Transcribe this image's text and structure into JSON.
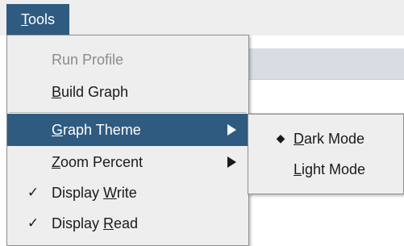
{
  "menubar": {
    "tools_menu": {
      "mnemonic": "T",
      "rest": "ools"
    }
  },
  "tools_menu": {
    "items": [
      {
        "pre": "Run Profile",
        "mnemonic": "",
        "post": "",
        "enabled": false
      },
      {
        "pre": "",
        "mnemonic": "B",
        "post": "uild Graph",
        "enabled": true
      },
      {
        "pre": "",
        "mnemonic": "G",
        "post": "raph Theme",
        "has_submenu": true,
        "highlighted": true,
        "submenu_icon": "chevron-right-icon"
      },
      {
        "pre": "",
        "mnemonic": "Z",
        "post": "oom Percent",
        "has_submenu": true,
        "submenu_icon": "chevron-right-icon"
      },
      {
        "check": "✓",
        "checked": true,
        "pre": "Display ",
        "mnemonic": "W",
        "post": "rite"
      },
      {
        "check": "✓",
        "checked": true,
        "pre": "Display ",
        "mnemonic": "R",
        "post": "ead"
      }
    ]
  },
  "graph_theme_submenu": {
    "items": [
      {
        "bullet": "◆",
        "selected": true,
        "pre": "",
        "mnemonic": "D",
        "post": "ark Mode"
      },
      {
        "bullet": "",
        "selected": false,
        "pre": "",
        "mnemonic": "L",
        "post": "ight Mode"
      }
    ]
  },
  "colors": {
    "highlight": "#2f5b80",
    "menu_background": "#eeeeee",
    "disabled_text": "#8c8c8c"
  }
}
